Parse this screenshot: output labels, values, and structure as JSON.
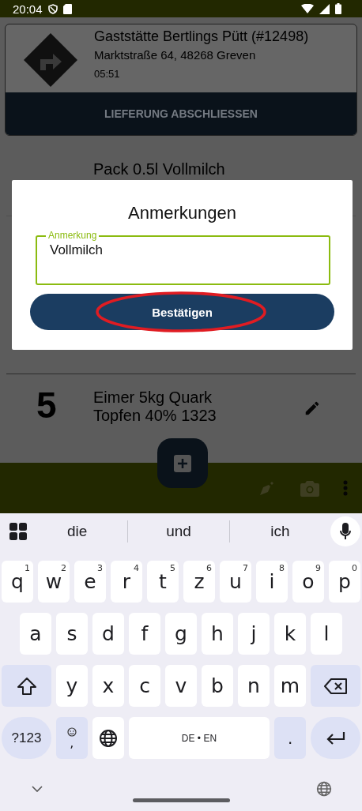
{
  "status_bar": {
    "time": "20:04"
  },
  "delivery": {
    "title": "Gaststätte Bertlings Pütt (#12498)",
    "address": "Marktstraße 64, 48268 Greven",
    "time": "05:51",
    "action": "LIEFERUNG ABSCHLIESSEN"
  },
  "items": [
    {
      "name": "Pack 0.5l Vollmilch"
    },
    {
      "number": "5",
      "name": "Eimer 5kg Quark Topfen 40% 1323"
    }
  ],
  "dialog": {
    "title": "Anmerkungen",
    "field_label": "Anmerkung",
    "value": "Vollmilch",
    "button": "Bestätigen",
    "button_circled": true
  },
  "keyboard": {
    "suggestions": [
      "die",
      "und",
      "ich"
    ],
    "rows": [
      {
        "keys": [
          {
            "kind": "letter",
            "label": "q",
            "hint": "1"
          },
          {
            "kind": "letter",
            "label": "w",
            "hint": "2"
          },
          {
            "kind": "letter",
            "label": "e",
            "hint": "3"
          },
          {
            "kind": "letter",
            "label": "r",
            "hint": "4"
          },
          {
            "kind": "letter",
            "label": "t",
            "hint": "5"
          },
          {
            "kind": "letter",
            "label": "z",
            "hint": "6"
          },
          {
            "kind": "letter",
            "label": "u",
            "hint": "7"
          },
          {
            "kind": "letter",
            "label": "i",
            "hint": "8"
          },
          {
            "kind": "letter",
            "label": "o",
            "hint": "9"
          },
          {
            "kind": "letter",
            "label": "p",
            "hint": "0"
          }
        ]
      },
      {
        "keys": [
          {
            "kind": "letter",
            "label": "a"
          },
          {
            "kind": "letter",
            "label": "s"
          },
          {
            "kind": "letter",
            "label": "d"
          },
          {
            "kind": "letter",
            "label": "f"
          },
          {
            "kind": "letter",
            "label": "g"
          },
          {
            "kind": "letter",
            "label": "h"
          },
          {
            "kind": "letter",
            "label": "j"
          },
          {
            "kind": "letter",
            "label": "k"
          },
          {
            "kind": "letter",
            "label": "l"
          }
        ]
      },
      {
        "keys": [
          {
            "kind": "shift"
          },
          {
            "kind": "letter",
            "label": "y"
          },
          {
            "kind": "letter",
            "label": "x"
          },
          {
            "kind": "letter",
            "label": "c"
          },
          {
            "kind": "letter",
            "label": "v"
          },
          {
            "kind": "letter",
            "label": "b"
          },
          {
            "kind": "letter",
            "label": "n"
          },
          {
            "kind": "letter",
            "label": "m"
          },
          {
            "kind": "backspace"
          }
        ]
      },
      {
        "keys": [
          {
            "kind": "symbols",
            "label": "?123"
          },
          {
            "kind": "emoji",
            "label": ","
          },
          {
            "kind": "globe"
          },
          {
            "kind": "space",
            "label": "DE • EN"
          },
          {
            "kind": "period",
            "label": "."
          },
          {
            "kind": "enter"
          }
        ]
      }
    ]
  }
}
